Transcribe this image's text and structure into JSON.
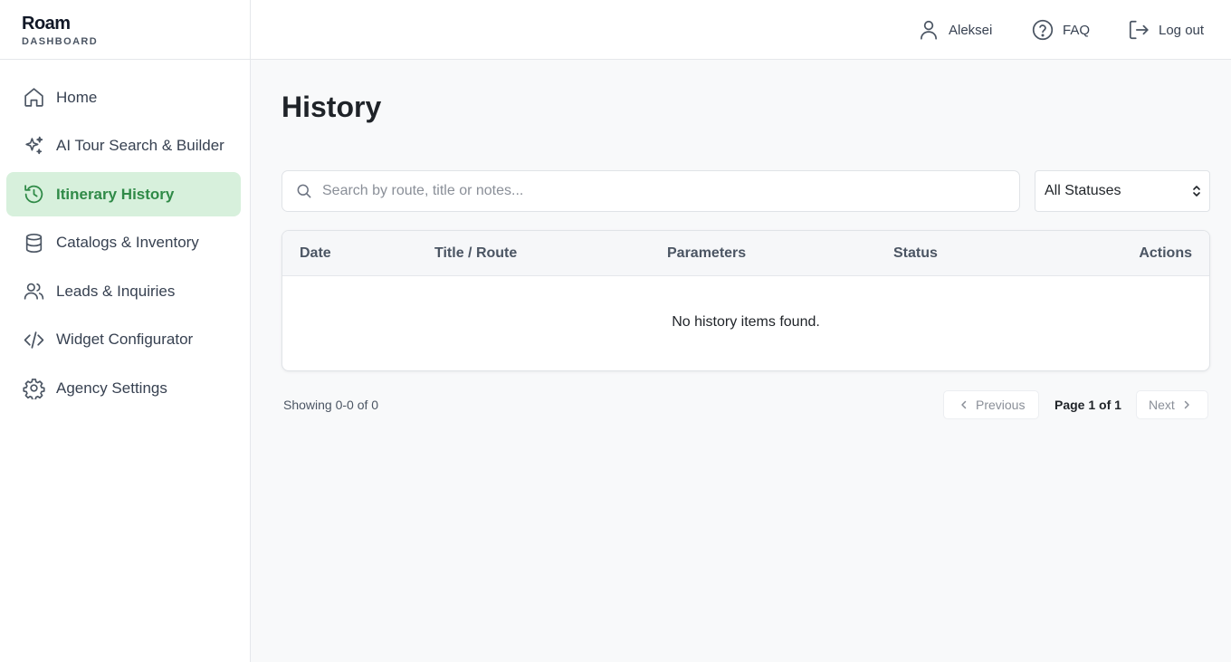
{
  "brand": {
    "name": "Roam",
    "subtitle": "DASHBOARD"
  },
  "sidebar": {
    "items": [
      {
        "label": "Home",
        "icon": "home-icon",
        "active": false
      },
      {
        "label": "AI Tour Search & Builder",
        "icon": "sparkles-icon",
        "active": false
      },
      {
        "label": "Itinerary History",
        "icon": "history-icon",
        "active": true
      },
      {
        "label": "Catalogs & Inventory",
        "icon": "database-icon",
        "active": false
      },
      {
        "label": "Leads & Inquiries",
        "icon": "users-icon",
        "active": false
      },
      {
        "label": "Widget Configurator",
        "icon": "code-icon",
        "active": false
      },
      {
        "label": "Agency Settings",
        "icon": "gear-icon",
        "active": false
      }
    ]
  },
  "topbar": {
    "user_label": "Aleksei",
    "faq_label": "FAQ",
    "logout_label": "Log out"
  },
  "main": {
    "title": "History",
    "search": {
      "placeholder": "Search by route, title or notes...",
      "value": ""
    },
    "status_filter": {
      "selected": "All Statuses"
    },
    "table": {
      "columns": [
        "Date",
        "Title / Route",
        "Parameters",
        "Status",
        "Actions"
      ],
      "empty_message": "No history items found."
    },
    "pagination": {
      "showing": "Showing 0-0 of 0",
      "previous_label": "Previous",
      "page_info": "Page 1 of 1",
      "next_label": "Next"
    }
  },
  "colors": {
    "accent": "#2f8a47",
    "active_bg": "#d7f0dc"
  }
}
